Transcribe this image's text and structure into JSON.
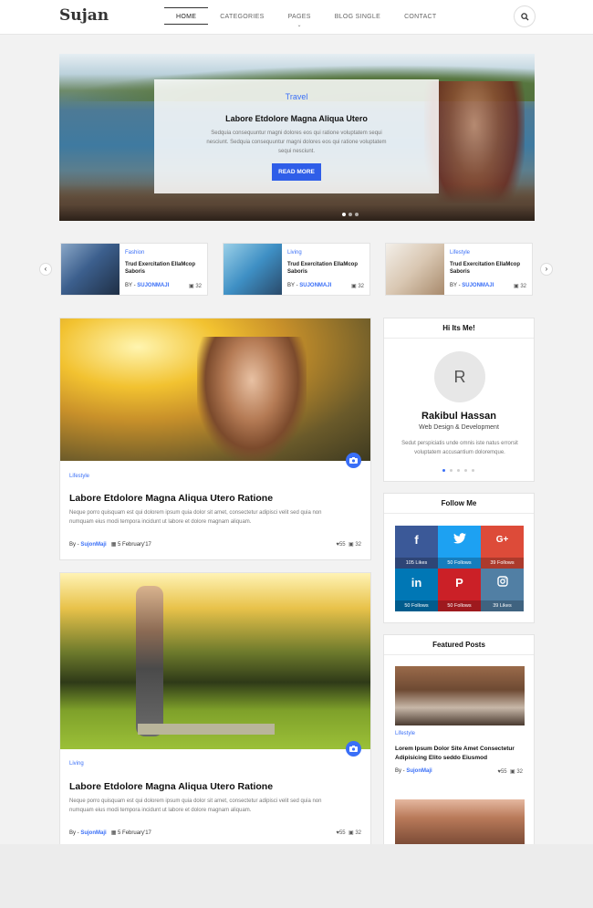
{
  "header": {
    "logo": "Sujan",
    "nav": [
      {
        "label": "HOME",
        "active": true
      },
      {
        "label": "CATEGORIES"
      },
      {
        "label": "PAGES",
        "has_dropdown": true
      },
      {
        "label": "BLOG SINGLE"
      },
      {
        "label": "CONTACT"
      }
    ],
    "search_icon": "search-icon"
  },
  "hero": {
    "category": "Travel",
    "title": "Labore Etdolore Magna Aliqua Utero",
    "text": "Sedquia consequuntur magni dolores eos qui ratione voluptatem sequi nesciunt. Sedquia consequuntur magni dolores eos qui ratione voluptatem sequi nesciunt.",
    "button": "READ MORE"
  },
  "mini_posts": [
    {
      "category": "Fashion",
      "title": "Trud Exercitation EllaMcop Saboris",
      "by": "BY - ",
      "author": "SUJONMAJI",
      "comments": "32"
    },
    {
      "category": "Living",
      "title": "Trud Exercitation EllaMcop Saboris",
      "by": "BY - ",
      "author": "SUJONMAJI",
      "comments": "32"
    },
    {
      "category": "Lifestyle",
      "title": "Trud Exercitation EllaMcop Saboris",
      "by": "BY - ",
      "author": "SUJONMAJI",
      "comments": "32"
    }
  ],
  "posts": [
    {
      "category": "Lifestyle",
      "title": "Labore Etdolore Magna Aliqua Utero Ratione",
      "text": "Neque porro quisquam est qui dolorem ipsum quia dolor sit amet, consectetur adipisci velit sed quia non numquam eius modi tempora incidunt ut labore et dolore magnam aliquam.",
      "by": "By - ",
      "author": "SujonMaji",
      "date": "5 February'17",
      "likes": "55",
      "comments": "32"
    },
    {
      "category": "Living",
      "title": "Labore Etdolore Magna Aliqua Utero Ratione",
      "text": "Neque porro quisquam est qui dolorem ipsum quia dolor sit amet, consectetur adipisci velit sed quia non numquam eius modi tempora incidunt ut labore et dolore magnam aliquam.",
      "by": "By - ",
      "author": "SujonMaji",
      "date": "5 February'17",
      "likes": "55",
      "comments": "32"
    }
  ],
  "about": {
    "title": "Hi Its Me!",
    "initial": "R",
    "name": "Rakibul Hassan",
    "role": "Web Design & Development",
    "desc": "Sedut perspiciatis unde omnis iste natus errorsit voluptatem accusantium doloremque."
  },
  "follow": {
    "title": "Follow Me",
    "items": [
      {
        "icon": "f",
        "label": "105 Likes",
        "color": "#3b5998"
      },
      {
        "icon": "t",
        "label": "50 Follows",
        "color": "#1da1f2"
      },
      {
        "icon": "G+",
        "label": "39 Follows",
        "color": "#dd4b39"
      },
      {
        "icon": "in",
        "label": "50 Follows",
        "color": "#0077b5"
      },
      {
        "icon": "P",
        "label": "50 Follows",
        "color": "#cb2027"
      },
      {
        "icon": "ig",
        "label": "39 Likes",
        "color": "#517fa4"
      }
    ]
  },
  "featured": {
    "title": "Featured Posts",
    "post": {
      "category": "Lifestyle",
      "title": "Lorem Ipsum Dolor Site Amet Consectetur Adipisicing Elito seddo Eiusmod",
      "by": "By - ",
      "author": "SujonMaji",
      "likes": "55",
      "comments": "32"
    }
  },
  "colors": {
    "accent": "#3a6ff7"
  }
}
